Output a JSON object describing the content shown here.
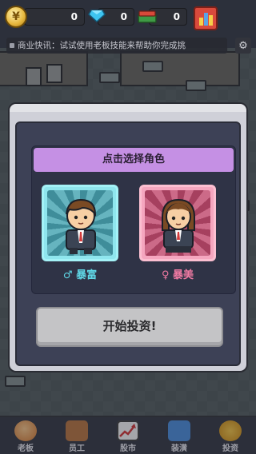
{
  "hud": {
    "coin_symbol": "¥",
    "coins": "0",
    "gems": "0",
    "cash": "0"
  },
  "ticker": {
    "text": "商业快讯：试试使用老板技能来帮助你完成挑"
  },
  "modal": {
    "header": "点击选择角色",
    "characters": [
      {
        "symbol": "♂",
        "name": "暴富"
      },
      {
        "symbol": "♀",
        "name": "暴美"
      }
    ],
    "start_label": "开始投资!"
  },
  "nav": {
    "items": [
      {
        "label": "老板",
        "icon": "boss-icon"
      },
      {
        "label": "员工",
        "icon": "staff-icon"
      },
      {
        "label": "股市",
        "icon": "stock-chart-icon"
      },
      {
        "label": "装潢",
        "icon": "decor-icon"
      },
      {
        "label": "投资",
        "icon": "invest-icon"
      }
    ]
  },
  "colors": {
    "header_purple": "#c590e4",
    "male_accent": "#5fd7e6",
    "female_accent": "#f07aa3"
  }
}
